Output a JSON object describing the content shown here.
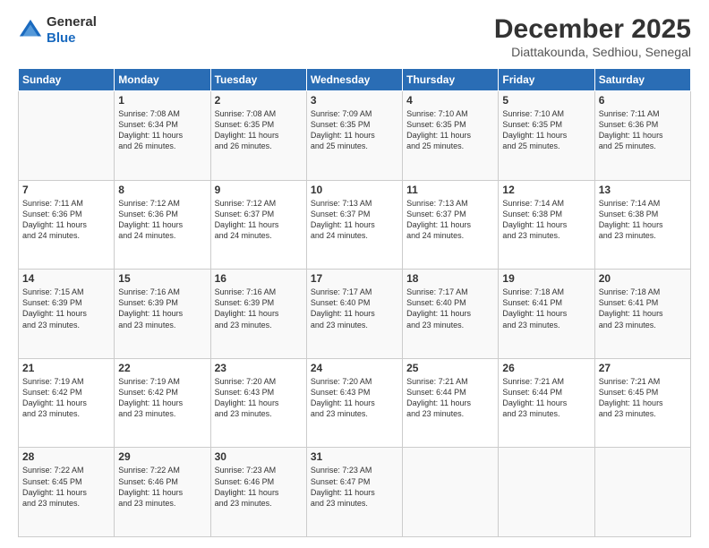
{
  "header": {
    "logo": {
      "line1": "General",
      "line2": "Blue"
    },
    "title": "December 2025",
    "location": "Diattakounda, Sedhiou, Senegal"
  },
  "days_of_week": [
    "Sunday",
    "Monday",
    "Tuesday",
    "Wednesday",
    "Thursday",
    "Friday",
    "Saturday"
  ],
  "weeks": [
    [
      {
        "day": "",
        "info": ""
      },
      {
        "day": "1",
        "info": "Sunrise: 7:08 AM\nSunset: 6:34 PM\nDaylight: 11 hours\nand 26 minutes."
      },
      {
        "day": "2",
        "info": "Sunrise: 7:08 AM\nSunset: 6:35 PM\nDaylight: 11 hours\nand 26 minutes."
      },
      {
        "day": "3",
        "info": "Sunrise: 7:09 AM\nSunset: 6:35 PM\nDaylight: 11 hours\nand 25 minutes."
      },
      {
        "day": "4",
        "info": "Sunrise: 7:10 AM\nSunset: 6:35 PM\nDaylight: 11 hours\nand 25 minutes."
      },
      {
        "day": "5",
        "info": "Sunrise: 7:10 AM\nSunset: 6:35 PM\nDaylight: 11 hours\nand 25 minutes."
      },
      {
        "day": "6",
        "info": "Sunrise: 7:11 AM\nSunset: 6:36 PM\nDaylight: 11 hours\nand 25 minutes."
      }
    ],
    [
      {
        "day": "7",
        "info": "Sunrise: 7:11 AM\nSunset: 6:36 PM\nDaylight: 11 hours\nand 24 minutes."
      },
      {
        "day": "8",
        "info": "Sunrise: 7:12 AM\nSunset: 6:36 PM\nDaylight: 11 hours\nand 24 minutes."
      },
      {
        "day": "9",
        "info": "Sunrise: 7:12 AM\nSunset: 6:37 PM\nDaylight: 11 hours\nand 24 minutes."
      },
      {
        "day": "10",
        "info": "Sunrise: 7:13 AM\nSunset: 6:37 PM\nDaylight: 11 hours\nand 24 minutes."
      },
      {
        "day": "11",
        "info": "Sunrise: 7:13 AM\nSunset: 6:37 PM\nDaylight: 11 hours\nand 24 minutes."
      },
      {
        "day": "12",
        "info": "Sunrise: 7:14 AM\nSunset: 6:38 PM\nDaylight: 11 hours\nand 23 minutes."
      },
      {
        "day": "13",
        "info": "Sunrise: 7:14 AM\nSunset: 6:38 PM\nDaylight: 11 hours\nand 23 minutes."
      }
    ],
    [
      {
        "day": "14",
        "info": "Sunrise: 7:15 AM\nSunset: 6:39 PM\nDaylight: 11 hours\nand 23 minutes."
      },
      {
        "day": "15",
        "info": "Sunrise: 7:16 AM\nSunset: 6:39 PM\nDaylight: 11 hours\nand 23 minutes."
      },
      {
        "day": "16",
        "info": "Sunrise: 7:16 AM\nSunset: 6:39 PM\nDaylight: 11 hours\nand 23 minutes."
      },
      {
        "day": "17",
        "info": "Sunrise: 7:17 AM\nSunset: 6:40 PM\nDaylight: 11 hours\nand 23 minutes."
      },
      {
        "day": "18",
        "info": "Sunrise: 7:17 AM\nSunset: 6:40 PM\nDaylight: 11 hours\nand 23 minutes."
      },
      {
        "day": "19",
        "info": "Sunrise: 7:18 AM\nSunset: 6:41 PM\nDaylight: 11 hours\nand 23 minutes."
      },
      {
        "day": "20",
        "info": "Sunrise: 7:18 AM\nSunset: 6:41 PM\nDaylight: 11 hours\nand 23 minutes."
      }
    ],
    [
      {
        "day": "21",
        "info": "Sunrise: 7:19 AM\nSunset: 6:42 PM\nDaylight: 11 hours\nand 23 minutes."
      },
      {
        "day": "22",
        "info": "Sunrise: 7:19 AM\nSunset: 6:42 PM\nDaylight: 11 hours\nand 23 minutes."
      },
      {
        "day": "23",
        "info": "Sunrise: 7:20 AM\nSunset: 6:43 PM\nDaylight: 11 hours\nand 23 minutes."
      },
      {
        "day": "24",
        "info": "Sunrise: 7:20 AM\nSunset: 6:43 PM\nDaylight: 11 hours\nand 23 minutes."
      },
      {
        "day": "25",
        "info": "Sunrise: 7:21 AM\nSunset: 6:44 PM\nDaylight: 11 hours\nand 23 minutes."
      },
      {
        "day": "26",
        "info": "Sunrise: 7:21 AM\nSunset: 6:44 PM\nDaylight: 11 hours\nand 23 minutes."
      },
      {
        "day": "27",
        "info": "Sunrise: 7:21 AM\nSunset: 6:45 PM\nDaylight: 11 hours\nand 23 minutes."
      }
    ],
    [
      {
        "day": "28",
        "info": "Sunrise: 7:22 AM\nSunset: 6:45 PM\nDaylight: 11 hours\nand 23 minutes."
      },
      {
        "day": "29",
        "info": "Sunrise: 7:22 AM\nSunset: 6:46 PM\nDaylight: 11 hours\nand 23 minutes."
      },
      {
        "day": "30",
        "info": "Sunrise: 7:23 AM\nSunset: 6:46 PM\nDaylight: 11 hours\nand 23 minutes."
      },
      {
        "day": "31",
        "info": "Sunrise: 7:23 AM\nSunset: 6:47 PM\nDaylight: 11 hours\nand 23 minutes."
      },
      {
        "day": "",
        "info": ""
      },
      {
        "day": "",
        "info": ""
      },
      {
        "day": "",
        "info": ""
      }
    ]
  ]
}
